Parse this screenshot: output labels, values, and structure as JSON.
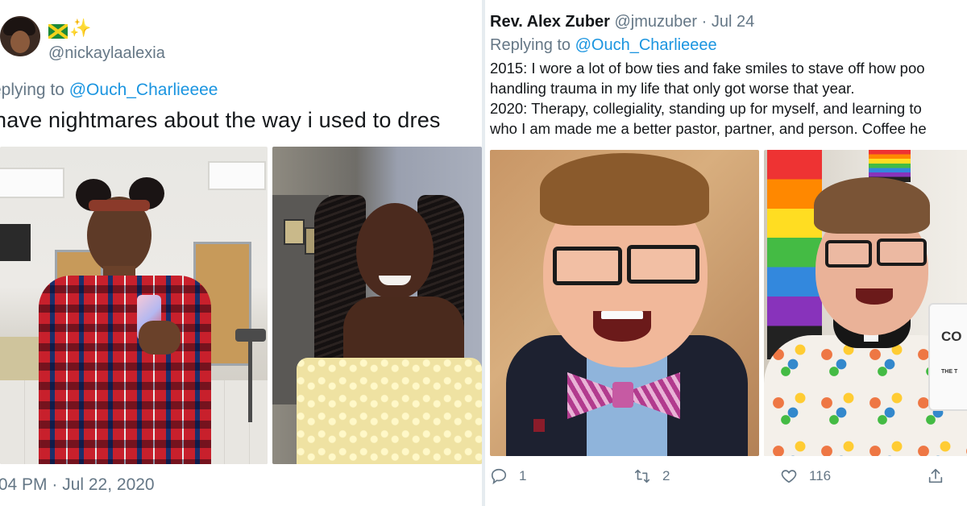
{
  "left_tweet": {
    "emoji_icons": [
      "jamaica-flag-icon",
      "sparkles-icon"
    ],
    "handle": "@nickaylaalexia",
    "replying_prefix": "eplying to ",
    "replying_to": "@Ouch_Charlieeee",
    "text": "have nightmares about the way i used to dres",
    "timestamp": ":04 PM · Jul 22, 2020"
  },
  "right_tweet": {
    "name": "Rev. Alex Zuber",
    "handle": "@jmuzuber",
    "separator": "·",
    "date": "Jul 24",
    "replying_prefix": "Replying to ",
    "replying_to": "@Ouch_Charlieeee",
    "lines": [
      "2015: I wore a lot of bow ties and fake smiles to stave off how poo",
      "handling trauma in my life that only got worse that year.",
      "2020: Therapy, collegiality, standing up for myself, and learning to",
      "who I am made me a better pastor, partner, and person. Coffee he"
    ],
    "mug_text": "CO",
    "mug_small_text": "THE T",
    "actions": {
      "reply_count": "1",
      "retweet_count": "2",
      "like_count": "116"
    }
  },
  "colors": {
    "link": "#1b95e0",
    "muted": "#657786",
    "text": "#14171a",
    "divider": "#e6ecf0"
  }
}
